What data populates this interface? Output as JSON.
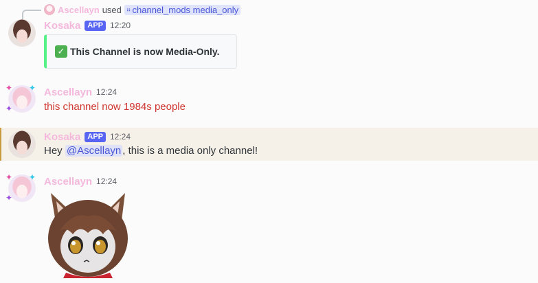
{
  "reply": {
    "user": "Ascellayn",
    "used": "used",
    "command": "channel_mods media_only"
  },
  "messages": [
    {
      "author": "Kosaka",
      "badge": "APP",
      "time": "12:20",
      "embed_text": "This Channel is now Media-Only."
    },
    {
      "author": "Ascellayn",
      "time": "12:24",
      "text": "this channel now 1984s people"
    },
    {
      "author": "Kosaka",
      "badge": "APP",
      "time": "12:24",
      "text_before": "Hey ",
      "mention": "@Ascellayn",
      "text_after": ", this is a media only channel!"
    },
    {
      "author": "Ascellayn",
      "time": "12:24",
      "attachment": "cat-girl-plush-image"
    }
  ],
  "colors": {
    "username": "#f4b8dc",
    "app_badge": "#5865f2",
    "embed_bar": "#57f287",
    "red_text": "#d0362f",
    "mention_bg": "#f6f1e8",
    "mention_bar": "#c89a3e"
  }
}
